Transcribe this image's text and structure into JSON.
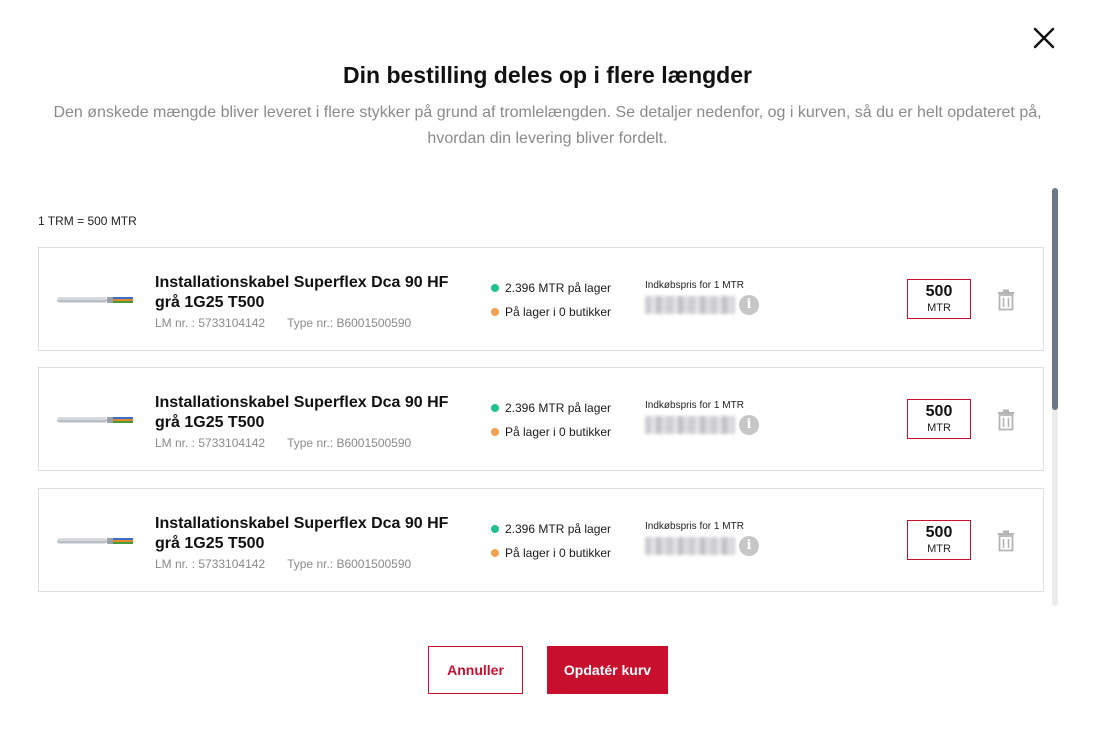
{
  "modal": {
    "title": "Din bestilling deles op i flere længder",
    "subtitle": "Den ønskede mængde bliver leveret i flere stykker på grund af tromlelængden. Se detaljer nedenfor, og i kurven, så du er helt opdateret på, hvordan din levering bliver fordelt.",
    "close_icon": "close-icon"
  },
  "conversion": "1 TRM = 500 MTR",
  "items": [
    {
      "name": "Installationskabel Superflex Dca 90 HF grå 1G25 T500",
      "lm": "LM nr. : 5733104142",
      "type": "Type nr.: B6001500590",
      "stock_main": "2.396 MTR på lager",
      "stock_store": "På lager i 0 butikker",
      "price_label": "Indkøbspris for 1 MTR",
      "info": "i",
      "qty": "500",
      "unit": "MTR"
    },
    {
      "name": "Installationskabel Superflex Dca 90 HF grå 1G25 T500",
      "lm": "LM nr. : 5733104142",
      "type": "Type nr.: B6001500590",
      "stock_main": "2.396 MTR på lager",
      "stock_store": "På lager i 0 butikker",
      "price_label": "Indkøbspris for 1 MTR",
      "info": "i",
      "qty": "500",
      "unit": "MTR"
    },
    {
      "name": "Installationskabel Superflex Dca 90 HF grå 1G25 T500",
      "lm": "LM nr. : 5733104142",
      "type": "Type nr.: B6001500590",
      "stock_main": "2.396 MTR på lager",
      "stock_store": "På lager i 0 butikker",
      "price_label": "Indkøbspris for 1 MTR",
      "info": "i",
      "qty": "500",
      "unit": "MTR"
    }
  ],
  "buttons": {
    "cancel": "Annuller",
    "update": "Opdatér kurv"
  },
  "colors": {
    "accent": "#c8102e",
    "in_stock": "#1fc28f",
    "store_stock": "#f0a250",
    "muted_text": "#8a8a8a"
  },
  "icons": {
    "cable": "cable-product-image",
    "delete": "trash-icon",
    "info": "info-icon"
  }
}
